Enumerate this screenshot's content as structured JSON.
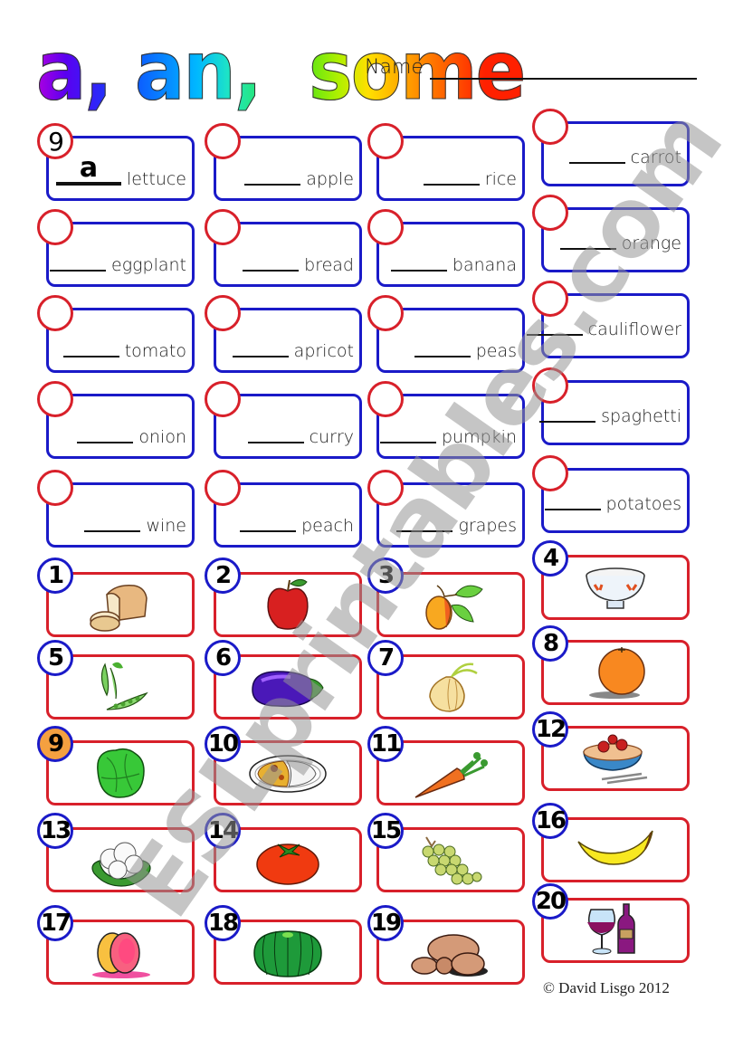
{
  "header": {
    "title": "a, an,  some",
    "name_label": "Name"
  },
  "word_cards": [
    {
      "column": 1,
      "row": 1,
      "word": "lettuce",
      "answer": "a",
      "number": "9"
    },
    {
      "column": 2,
      "row": 1,
      "word": "apple",
      "answer": "",
      "number": ""
    },
    {
      "column": 3,
      "row": 1,
      "word": "rice",
      "answer": "",
      "number": ""
    },
    {
      "column": 4,
      "row": 1,
      "word": "carrot",
      "answer": "",
      "number": ""
    },
    {
      "column": 1,
      "row": 2,
      "word": "eggplant",
      "answer": "",
      "number": ""
    },
    {
      "column": 2,
      "row": 2,
      "word": "bread",
      "answer": "",
      "number": ""
    },
    {
      "column": 3,
      "row": 2,
      "word": "banana",
      "answer": "",
      "number": ""
    },
    {
      "column": 4,
      "row": 2,
      "word": "orange",
      "answer": "",
      "number": ""
    },
    {
      "column": 1,
      "row": 3,
      "word": "tomato",
      "answer": "",
      "number": ""
    },
    {
      "column": 2,
      "row": 3,
      "word": "apricot",
      "answer": "",
      "number": ""
    },
    {
      "column": 3,
      "row": 3,
      "word": "peas",
      "answer": "",
      "number": ""
    },
    {
      "column": 4,
      "row": 3,
      "word": "cauliflower",
      "answer": "",
      "number": ""
    },
    {
      "column": 1,
      "row": 4,
      "word": "onion",
      "answer": "",
      "number": ""
    },
    {
      "column": 2,
      "row": 4,
      "word": "curry",
      "answer": "",
      "number": ""
    },
    {
      "column": 3,
      "row": 4,
      "word": "pumpkin",
      "answer": "",
      "number": ""
    },
    {
      "column": 4,
      "row": 4,
      "word": "spaghetti",
      "answer": "",
      "number": ""
    },
    {
      "column": 1,
      "row": 5,
      "word": "wine",
      "answer": "",
      "number": ""
    },
    {
      "column": 2,
      "row": 5,
      "word": "peach",
      "answer": "",
      "number": ""
    },
    {
      "column": 3,
      "row": 5,
      "word": "grapes",
      "answer": "",
      "number": ""
    },
    {
      "column": 4,
      "row": 5,
      "word": "potatoes",
      "answer": "",
      "number": ""
    }
  ],
  "picture_cards": [
    {
      "number": "1",
      "picture": "bread-icon",
      "highlighted": false
    },
    {
      "number": "2",
      "picture": "apple-icon",
      "highlighted": false
    },
    {
      "number": "3",
      "picture": "apricot-icon",
      "highlighted": false
    },
    {
      "number": "4",
      "picture": "rice-bowl-icon",
      "highlighted": false
    },
    {
      "number": "5",
      "picture": "peas-icon",
      "highlighted": false
    },
    {
      "number": "6",
      "picture": "eggplant-icon",
      "highlighted": false
    },
    {
      "number": "7",
      "picture": "onion-icon",
      "highlighted": false
    },
    {
      "number": "8",
      "picture": "orange-icon",
      "highlighted": false
    },
    {
      "number": "9",
      "picture": "lettuce-icon",
      "highlighted": true
    },
    {
      "number": "10",
      "picture": "curry-icon",
      "highlighted": false
    },
    {
      "number": "11",
      "picture": "carrot-icon",
      "highlighted": false
    },
    {
      "number": "12",
      "picture": "spaghetti-icon",
      "highlighted": false
    },
    {
      "number": "13",
      "picture": "cauliflower-icon",
      "highlighted": false
    },
    {
      "number": "14",
      "picture": "tomato-icon",
      "highlighted": false
    },
    {
      "number": "15",
      "picture": "grapes-icon",
      "highlighted": false
    },
    {
      "number": "16",
      "picture": "banana-icon",
      "highlighted": false
    },
    {
      "number": "17",
      "picture": "peach-icon",
      "highlighted": false
    },
    {
      "number": "18",
      "picture": "pumpkin-icon",
      "highlighted": false
    },
    {
      "number": "19",
      "picture": "potatoes-icon",
      "highlighted": false
    },
    {
      "number": "20",
      "picture": "wine-icon",
      "highlighted": false
    }
  ],
  "colors": {
    "word_card_border": "#1a1ac8",
    "word_circle_border": "#d8202a",
    "picture_card_border": "#d8202a",
    "picture_circle_border": "#1a1ac8",
    "highlight_circle": "#f4a040"
  },
  "watermark": "ESLprintables.com",
  "footer": {
    "copyright": "© David Lisgo 2012"
  }
}
